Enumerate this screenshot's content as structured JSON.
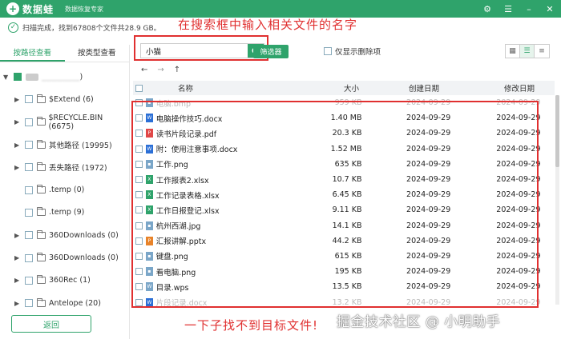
{
  "app": {
    "logo_mark": "+",
    "name": "数据蛙",
    "subtitle": "数据恢复专家",
    "brand_color": "#2fa36b"
  },
  "window_controls": [
    "⚙",
    "☰",
    "–",
    "✕"
  ],
  "status": {
    "text": "扫描完成，找到67808个文件共28.9 GB。"
  },
  "annotations": {
    "top": "在搜索框中输入相关文件的名字",
    "bottom": "一下子找不到目标文件!",
    "highlight_color": "#e03030"
  },
  "watermark": "掘金技术社区 @ 小明助手",
  "sidebar": {
    "tabs": [
      {
        "label": "按路径查看",
        "active": true
      },
      {
        "label": "按类型查看",
        "active": false
      }
    ],
    "root_suffix": ")",
    "items": [
      {
        "label": "$Extend (6)"
      },
      {
        "label": "$RECYCLE.BIN (6675)"
      },
      {
        "label": "其他路径 (19995)"
      },
      {
        "label": "丢失路径 (1972)"
      },
      {
        "label": ".temp (0)"
      },
      {
        "label": ".temp (9)"
      },
      {
        "label": "360Downloads (0)"
      },
      {
        "label": "360Downloads (0)"
      },
      {
        "label": "360Rec (1)"
      },
      {
        "label": "Antelope (20)"
      }
    ],
    "back_label": "返回"
  },
  "search": {
    "value": "小猫",
    "filter_label": "筛选器",
    "only_deleted_label": "仅显示删除项"
  },
  "nav": {
    "back": "←",
    "forward": "→",
    "up": "↑"
  },
  "table": {
    "headers": {
      "name": "名称",
      "size": "大小",
      "created": "创建日期",
      "modified": "修改日期"
    },
    "rows": [
      {
        "name": "电脑.bmp",
        "size": "959 KB",
        "created": "2024-09-29",
        "modified": "2024-09-29",
        "type": "img"
      },
      {
        "name": "电脑操作技巧.docx",
        "size": "1.40 MB",
        "created": "2024-09-29",
        "modified": "2024-09-29",
        "type": "doc"
      },
      {
        "name": "读书片段记录.pdf",
        "size": "20.3 KB",
        "created": "2024-09-29",
        "modified": "2024-09-29",
        "type": "pdf"
      },
      {
        "name": "附：使用注意事项.docx",
        "size": "1.52 MB",
        "created": "2024-09-29",
        "modified": "2024-09-29",
        "type": "doc"
      },
      {
        "name": "工作.png",
        "size": "635 KB",
        "created": "2024-09-29",
        "modified": "2024-09-29",
        "type": "img"
      },
      {
        "name": "工作报表2.xlsx",
        "size": "10.7 KB",
        "created": "2024-09-29",
        "modified": "2024-09-29",
        "type": "xls"
      },
      {
        "name": "工作记录表格.xlsx",
        "size": "6.45 KB",
        "created": "2024-09-29",
        "modified": "2024-09-29",
        "type": "xls"
      },
      {
        "name": "工作日报登记.xlsx",
        "size": "9.11 KB",
        "created": "2024-09-29",
        "modified": "2024-09-29",
        "type": "xls"
      },
      {
        "name": "杭州西湖.jpg",
        "size": "14.1 KB",
        "created": "2024-09-29",
        "modified": "2024-09-29",
        "type": "img"
      },
      {
        "name": "汇报讲解.pptx",
        "size": "44.2 KB",
        "created": "2024-09-29",
        "modified": "2024-09-29",
        "type": "ppt"
      },
      {
        "name": "键盘.png",
        "size": "615 KB",
        "created": "2024-09-29",
        "modified": "2024-09-29",
        "type": "img"
      },
      {
        "name": "看电脑.png",
        "size": "195 KB",
        "created": "2024-09-29",
        "modified": "2024-09-29",
        "type": "img"
      },
      {
        "name": "目录.wps",
        "size": "13.5 KB",
        "created": "2024-09-29",
        "modified": "2024-09-29",
        "type": "wps"
      },
      {
        "name": "片段记录.docx",
        "size": "13.2 KB",
        "created": "2024-09-29",
        "modified": "2024-09-29",
        "type": "doc"
      }
    ]
  },
  "file_type_colors": {
    "doc": "#2b6fd6",
    "pdf": "#e04848",
    "xls": "#2fa36b",
    "ppt": "#e8832a",
    "img": "#7aa6c8",
    "wps": "#7aa6c8"
  }
}
